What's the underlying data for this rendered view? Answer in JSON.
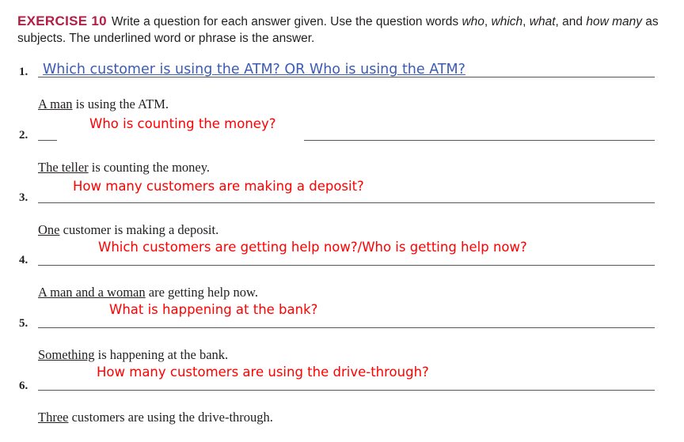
{
  "exercise": {
    "label": "EXERCISE 10",
    "instruction_1": "Write a question for each answer given. Use the question words ",
    "word_who": "who",
    "sep1": ", ",
    "word_which": "which",
    "sep2": ", ",
    "word_what": "what",
    "sep3": ", and ",
    "word_how_many": "how many",
    "instruction_2": " as subjects. The underlined word or phrase is the answer."
  },
  "items": [
    {
      "number": "1.",
      "answer": "Which customer is using the ATM? OR Who is using the ATM?",
      "prompt_underlined": "A man",
      "prompt_rest": " is using the ATM."
    },
    {
      "number": "2.",
      "answer": "Who is counting the money?",
      "prompt_underlined": "The teller",
      "prompt_rest": " is counting the money."
    },
    {
      "number": "3.",
      "answer": "How many customers are making a deposit?",
      "prompt_underlined": "One",
      "prompt_rest": " customer is making a deposit."
    },
    {
      "number": "4.",
      "answer": "Which customers are getting help now?/Who is getting help now?",
      "prompt_underlined": "A man and a woman",
      "prompt_rest": " are getting help now."
    },
    {
      "number": "5.",
      "answer": "What is happening at the bank?",
      "prompt_underlined": "Something",
      "prompt_rest": " is happening at the bank."
    },
    {
      "number": "6.",
      "answer": "How many customers are using the drive-through?",
      "prompt_underlined": "Three",
      "prompt_rest": " customers are using the drive-through."
    }
  ],
  "colors": {
    "exercise_label": "#b21f45",
    "handwritten_answer": "#3b5bb5",
    "typed_answer": "#ff0000"
  }
}
